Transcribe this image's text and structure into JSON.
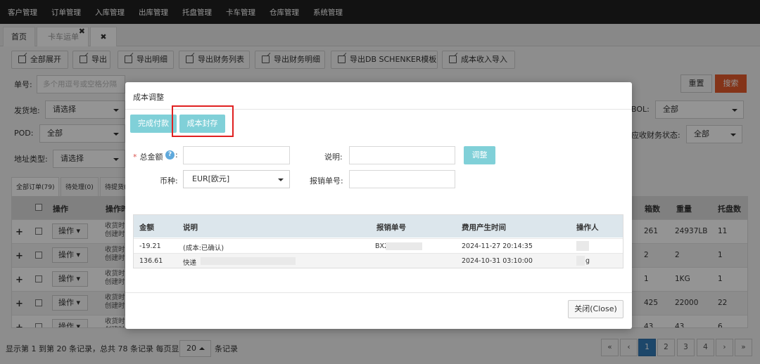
{
  "nav": [
    "客户管理",
    "订单管理",
    "入库管理",
    "出库管理",
    "托盘管理",
    "卡车管理",
    "仓库管理",
    "系统管理"
  ],
  "tabs": {
    "home": "首页",
    "active": "卡车运单",
    "active_close": "✖",
    "close_all": "✖"
  },
  "toolbar": [
    "全部展开",
    "导出",
    "导出明细",
    "导出财务列表",
    "导出财务明细",
    "导出DB SCHENKER模板",
    "成本收入导入"
  ],
  "filters": {
    "order_no_label": "单号:",
    "order_no_placeholder": "多个用逗号或空格分隔",
    "ship_from_label": "发货地:",
    "ship_from_value": "请选择",
    "pod_label": "POD:",
    "pod_value": "全部",
    "addr_type_label": "地址类型:",
    "addr_type_value": "请选择",
    "bol_label": "BOL:",
    "bol_value": "全部",
    "finance_label": "应收财务状态:",
    "finance_value": "全部",
    "reset": "重置",
    "search": "搜索"
  },
  "status_tabs": [
    "全部订单(79)",
    "待处理(0)",
    "待提货("
  ],
  "table": {
    "headers": {
      "op": "操作",
      "info": "操作时",
      "boxes": "箱数",
      "weight": "重量",
      "pallets": "托盘数"
    },
    "op_label": "操作",
    "row_info_1": "收货时",
    "row_info_2": "创建时",
    "rows": [
      {
        "boxes": "261",
        "weight": "24937LB",
        "pallets": "11"
      },
      {
        "boxes": "2",
        "weight": "2",
        "pallets": "1"
      },
      {
        "boxes": "1",
        "weight": "1KG",
        "pallets": "1"
      },
      {
        "boxes": "425",
        "weight": "22000",
        "pallets": "22"
      },
      {
        "boxes": "43",
        "weight": "43",
        "pallets": "6"
      }
    ]
  },
  "footer": {
    "summary": "显示第 1 到第 20 条记录，总共 78 条记录 每页显示",
    "page_size": "20",
    "suffix": "条记录",
    "pages": [
      "«",
      "‹",
      "1",
      "2",
      "3",
      "4",
      "›",
      "»"
    ]
  },
  "modal": {
    "title": "成本调整",
    "btn_complete": "完成付款",
    "btn_seal": "成本封存",
    "total_label": "总金额",
    "help": "?",
    "desc_label": "说明:",
    "adjust_btn": "调整",
    "currency_label": "币种:",
    "currency_value": "EUR[欧元]",
    "claim_label": "报销单号:",
    "table_headers": [
      "金额",
      "说明",
      "报销单号",
      "费用产生时间",
      "操作人"
    ],
    "rows": [
      {
        "amount": "-19.21",
        "desc": "(成本:已确认)",
        "claim": "BX2",
        "time": "2024-11-27 20:14:35",
        "operator": ""
      },
      {
        "amount": "136.61",
        "desc": "快递",
        "claim": "",
        "time": "2024-10-31 03:10:00",
        "operator": "g"
      }
    ],
    "close": "关闭(Close)"
  }
}
